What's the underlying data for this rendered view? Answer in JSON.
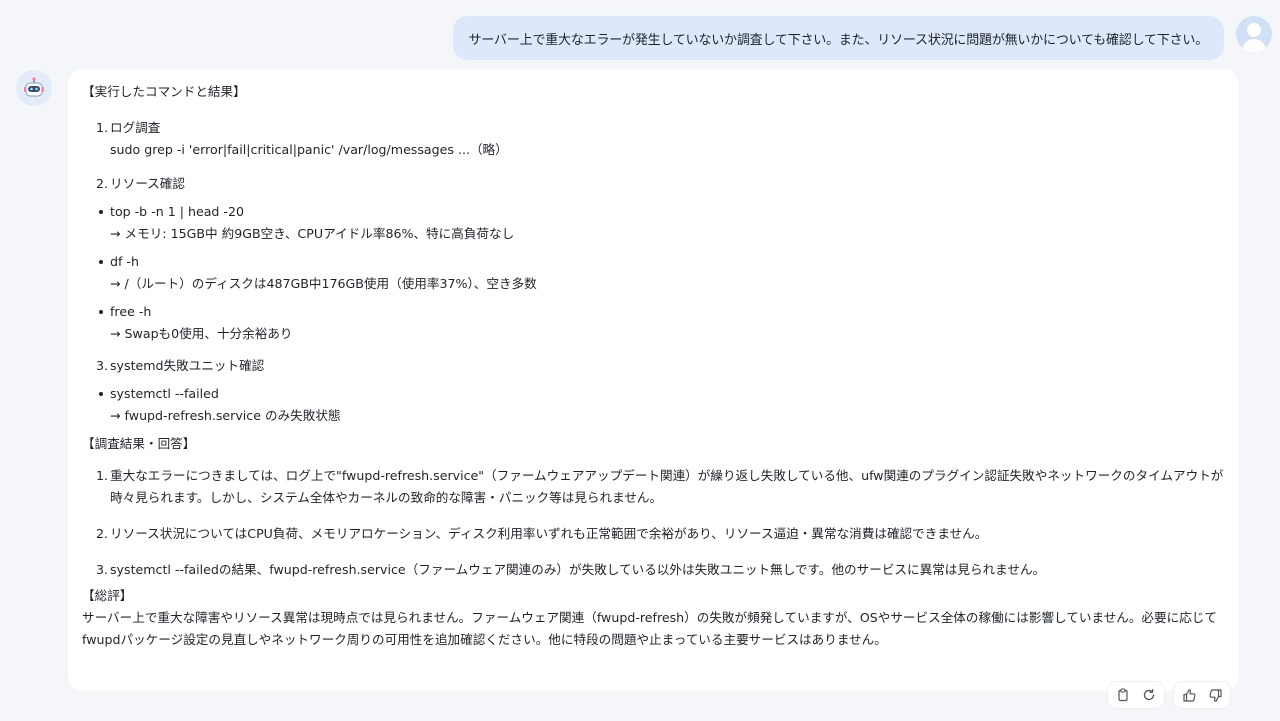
{
  "user_message": "サーバー上で重大なエラーが発生していないか調査して下さい。また、リソース状況に問題が無いかについても確認して下さい。",
  "response": {
    "commands_title": "【実行したコマンドと結果】",
    "step1": {
      "num": "1.",
      "label": "ログ調査",
      "cmd": "sudo grep -i 'error|fail|critical|panic' /var/log/messages ...（略）"
    },
    "step2": {
      "num": "2.",
      "label": "リソース確認"
    },
    "resource_bullets": [
      {
        "cmd": "top -b -n 1 | head -20",
        "result": "→ メモリ: 15GB中 約9GB空き、CPUアイドル率86%、特に高負荷なし"
      },
      {
        "cmd": "df -h",
        "result": "→ /（ルート）のディスクは487GB中176GB使用（使用率37%）、空き多数"
      },
      {
        "cmd": "free -h",
        "result": "→ Swapも0使用、十分余裕あり"
      }
    ],
    "step3": {
      "num": "3.",
      "label": "systemd失敗ユニット確認"
    },
    "systemd_bullet": {
      "cmd": "systemctl --failed",
      "result": "→ fwupd-refresh.service のみ失敗状態"
    },
    "findings_title": "【調査結果・回答】",
    "findings": [
      {
        "num": "1.",
        "text": "重大なエラーにつきましては、ログ上で\"fwupd-refresh.service\"（ファームウェアアップデート関連）が繰り返し失敗している他、ufw関連のプラグイン認証失敗やネットワークのタイムアウトが時々見られます。しかし、システム全体やカーネルの致命的な障害・パニック等は見られません。"
      },
      {
        "num": "2.",
        "text": "リソース状況についてはCPU負荷、メモリアロケーション、ディスク利用率いずれも正常範囲で余裕があり、リソース逼迫・異常な消費は確認できません。"
      },
      {
        "num": "3.",
        "text": "systemctl --failedの結果、fwupd-refresh.service（ファームウェア関連のみ）が失敗している以外は失敗ユニット無しです。他のサービスに異常は見られません。"
      }
    ],
    "summary_title": "【総評】",
    "summary_text": "サーバー上で重大な障害やリソース異常は現時点では見られません。ファームウェア関連（fwupd-refresh）の失敗が頻発していますが、OSやサービス全体の稼働には影響していません。必要に応じてfwupdパッケージ設定の見直しやネットワーク周りの可用性を追加確認ください。他に特段の問題や止まっている主要サービスはありません。"
  },
  "icons": {
    "bot_avatar": "robot-icon",
    "user_avatar": "user-icon",
    "copy": "copy-icon",
    "regenerate": "refresh-icon",
    "like": "thumbs-up-icon",
    "dislike": "thumbs-down-icon"
  },
  "colors": {
    "user_bubble": "#dde9fb",
    "background": "#f4f6fa",
    "card": "#ffffff"
  }
}
